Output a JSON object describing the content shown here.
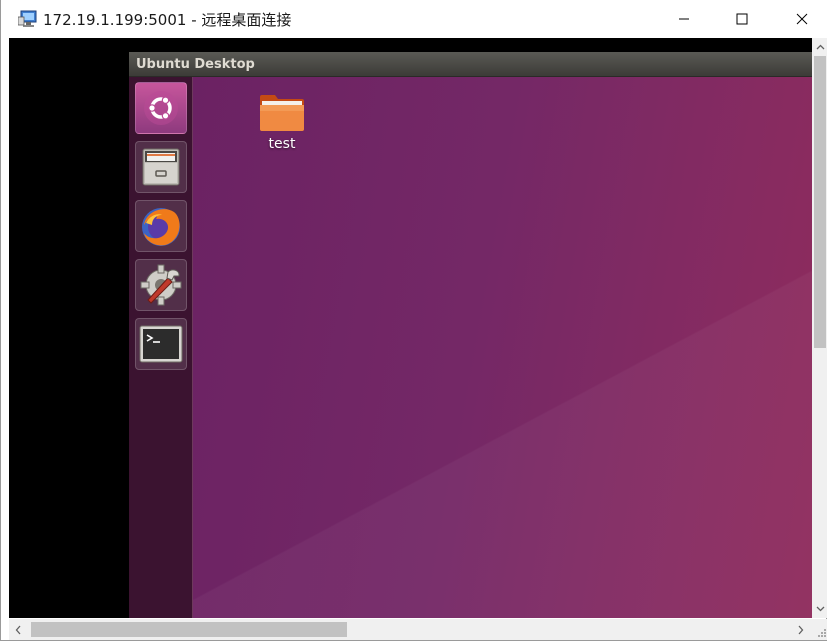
{
  "window": {
    "title": "172.19.1.199:5001 - 远程桌面连接",
    "icon": "remote-desktop-icon",
    "controls": [
      "minimize-icon",
      "maximize-icon",
      "close-icon"
    ]
  },
  "ubuntu": {
    "window_title": "Ubuntu Desktop",
    "launcher": [
      {
        "name": "dash-home",
        "icon": "ubuntu-logo-icon"
      },
      {
        "name": "files",
        "icon": "file-cabinet-icon"
      },
      {
        "name": "firefox",
        "icon": "firefox-icon"
      },
      {
        "name": "system-settings",
        "icon": "settings-wrench-icon"
      },
      {
        "name": "terminal",
        "icon": "terminal-icon"
      }
    ],
    "desktop_icons": [
      {
        "label": "test",
        "icon": "folder-icon"
      }
    ]
  },
  "colors": {
    "launcher_bg": "#3b1330",
    "desktop_bg": "#742866",
    "titlebar_bg": "#3c3b37"
  }
}
